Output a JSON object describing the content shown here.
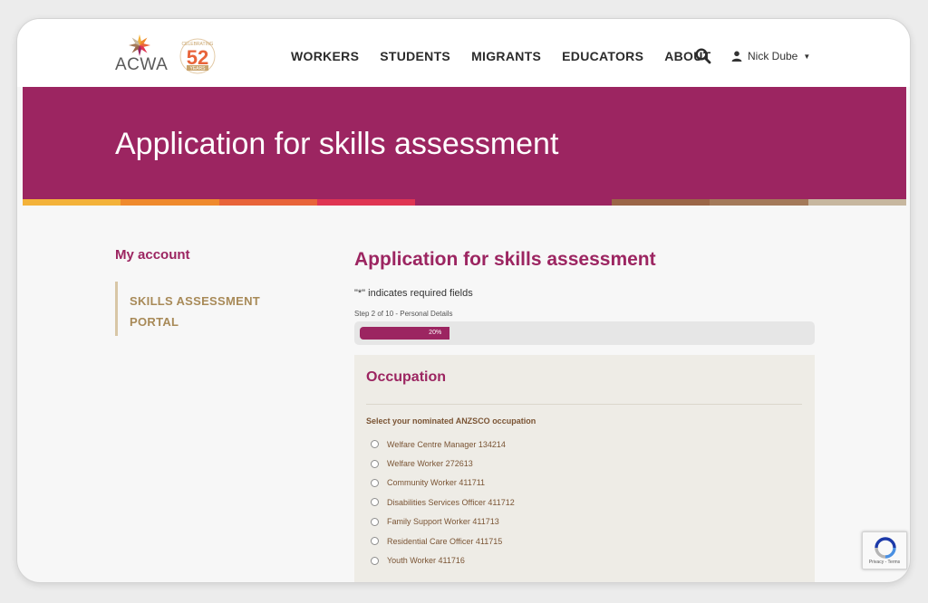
{
  "header": {
    "logo_text": "ACWA",
    "badge_number": "52",
    "badge_top_text": "CELEBRATING",
    "badge_bottom_text": "YEARS",
    "nav": [
      "WORKERS",
      "STUDENTS",
      "MIGRANTS",
      "EDUCATORS",
      "ABOUT"
    ],
    "user_name": "Nick Dube"
  },
  "banner": {
    "title": "Application for skills assessment"
  },
  "sidebar": {
    "title": "My account",
    "link_line1": "SKILLS ASSESSMENT",
    "link_line2": "PORTAL"
  },
  "main": {
    "title": "Application for skills assessment",
    "required_note": "\"*\" indicates required fields",
    "step_label": "Step 2 of 10 - Personal Details",
    "progress": {
      "percent": 20,
      "label": "20%"
    }
  },
  "form": {
    "section_title": "Occupation",
    "field_label": "Select your nominated ANZSCO occupation",
    "options": [
      "Welfare Centre Manager 134214",
      "Welfare Worker 272613",
      "Community Worker 411711",
      "Disabilities Services Officer 411712",
      "Family Support Worker 411713",
      "Residential Care Officer 411715",
      "Youth Worker 411716"
    ]
  },
  "recaptcha": {
    "text": "Privacy - Terms"
  },
  "colors": {
    "brand": "#9c2561",
    "gold": "#a88a58",
    "panel_bg": "#eeece6",
    "option_text": "#7a5434",
    "stripe": [
      "#f3b23a",
      "#ef8a2d",
      "#e8643a",
      "#df3553",
      "#9c2561",
      "#9c2561",
      "#9b6647",
      "#a47a5a",
      "#c7b79f"
    ]
  },
  "icons": {
    "search": "search-icon",
    "user": "user-icon",
    "caret": "caret-down-icon",
    "recaptcha": "recaptcha-icon"
  }
}
